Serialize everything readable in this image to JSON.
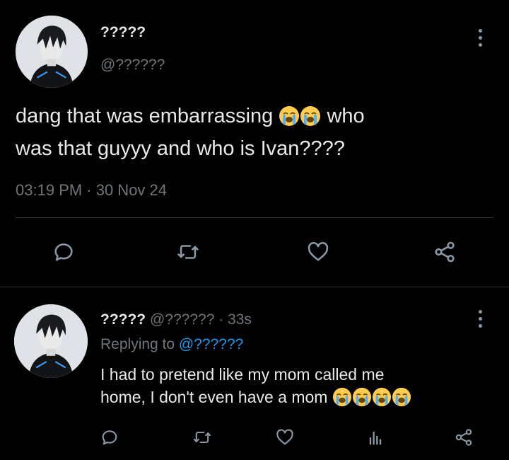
{
  "tweet": {
    "display_name": "?????",
    "handle": "@??????",
    "text_parts": [
      "dang that was embarrassing",
      "who",
      "was that guyyy and who is Ivan????"
    ],
    "text_emojis": [
      "loudly-crying-face",
      "loudly-crying-face"
    ],
    "timestamp": "03:19 PM · 30 Nov 24",
    "actions": [
      "reply-icon",
      "retweet-icon",
      "like-icon",
      "share-icon"
    ]
  },
  "reply": {
    "display_name": "?????",
    "handle_time": "@?????? · 33s",
    "replying_to_label": "Replying to",
    "replying_to_handle": "@??????",
    "text_line1": "I had to pretend like my mom called me",
    "text_line2": "home, I don't even have a mom",
    "text_emojis": [
      "loudly-crying-face",
      "loudly-crying-face",
      "loudly-crying-face",
      "loudly-crying-face"
    ],
    "actions": [
      "reply-icon",
      "retweet-icon",
      "like-icon",
      "analytics-icon",
      "share-icon"
    ]
  },
  "colors": {
    "background": "#000000",
    "text": "#e7e9ea",
    "muted": "#71767b",
    "link": "#1d9bf0",
    "divider": "#2f3336"
  }
}
